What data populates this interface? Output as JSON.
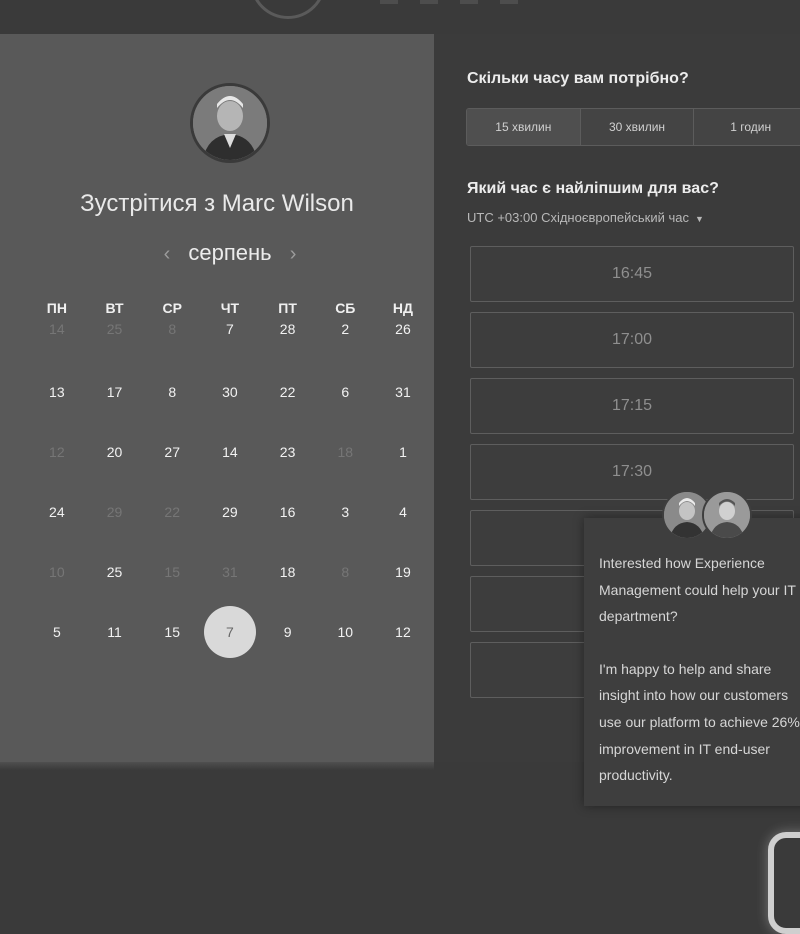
{
  "meeting": {
    "title": "Зустрітися з Marc Wilson",
    "month": "серпень",
    "prev_arrow": "‹",
    "next_arrow": "›"
  },
  "calendar": {
    "weekdays": [
      "ПН",
      "ВТ",
      "СР",
      "ЧТ",
      "ПТ",
      "СБ",
      "НД"
    ],
    "rows": [
      [
        {
          "d": "14",
          "m": true
        },
        {
          "d": "25",
          "m": true
        },
        {
          "d": "8",
          "m": true
        },
        {
          "d": "7",
          "m": false
        },
        {
          "d": "28",
          "m": false
        },
        {
          "d": "2",
          "m": false
        },
        {
          "d": "26",
          "m": false
        }
      ],
      [
        {
          "d": "13",
          "m": false
        },
        {
          "d": "17",
          "m": false
        },
        {
          "d": "8",
          "m": false
        },
        {
          "d": "30",
          "m": false
        },
        {
          "d": "22",
          "m": false
        },
        {
          "d": "6",
          "m": false
        },
        {
          "d": "31",
          "m": false
        }
      ],
      [
        {
          "d": "12",
          "m": true
        },
        {
          "d": "20",
          "m": false
        },
        {
          "d": "27",
          "m": false
        },
        {
          "d": "14",
          "m": false
        },
        {
          "d": "23",
          "m": false
        },
        {
          "d": "18",
          "m": true
        },
        {
          "d": "1",
          "m": false
        }
      ],
      [
        {
          "d": "24",
          "m": false
        },
        {
          "d": "29",
          "m": true
        },
        {
          "d": "22",
          "m": true
        },
        {
          "d": "29",
          "m": false
        },
        {
          "d": "16",
          "m": false
        },
        {
          "d": "3",
          "m": false
        },
        {
          "d": "4",
          "m": false
        }
      ],
      [
        {
          "d": "10",
          "m": true
        },
        {
          "d": "25",
          "m": false
        },
        {
          "d": "15",
          "m": true
        },
        {
          "d": "31",
          "m": true
        },
        {
          "d": "18",
          "m": false
        },
        {
          "d": "8",
          "m": true
        },
        {
          "d": "19",
          "m": false
        }
      ],
      [
        {
          "d": "5",
          "m": false
        },
        {
          "d": "11",
          "m": false
        },
        {
          "d": "15",
          "m": false
        },
        {
          "d": "7",
          "m": false,
          "selected": true
        },
        {
          "d": "9",
          "m": false
        },
        {
          "d": "10",
          "m": false
        },
        {
          "d": "12",
          "m": false
        }
      ]
    ]
  },
  "duration": {
    "question": "Скільки часу вам потрібно?",
    "options": [
      "15 хвилин",
      "30 хвилин",
      "1 годин"
    ]
  },
  "time": {
    "question": "Який час є найліпшим для вас?",
    "timezone": "UTC +03:00 Східноєвропейський час",
    "slots": [
      "16:45",
      "17:00",
      "17:15",
      "17:30",
      "",
      "",
      "",
      ""
    ]
  },
  "chat": {
    "paragraph1": "Interested how Experience Management could help your IT department?",
    "paragraph2": "I'm happy to help and share insight into how our customers use our platform to achieve 26% improvement in IT end-user productivity."
  }
}
